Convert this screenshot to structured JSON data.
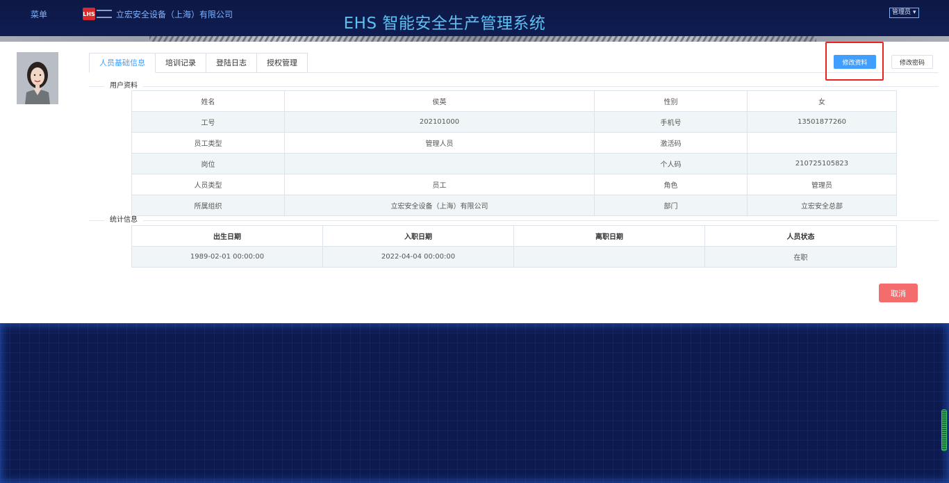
{
  "header": {
    "menu_label": "菜单",
    "company_name": "立宏安全设备（上海）有限公司",
    "system_title": "EHS 智能安全生产管理系统",
    "user_role": "管理员",
    "logo_text": "LHS"
  },
  "tabs": [
    {
      "label": "人员基础信息",
      "active": true
    },
    {
      "label": "培训记录",
      "active": false
    },
    {
      "label": "登陆日志",
      "active": false
    },
    {
      "label": "授权管理",
      "active": false
    }
  ],
  "actions": {
    "edit_label": "修改资料",
    "password_label": "修改密码",
    "cancel_label": "取消"
  },
  "user_profile": {
    "section_title": "用户资料",
    "rows": [
      [
        "姓名",
        "侯英",
        "性别",
        "女"
      ],
      [
        "工号",
        "202101000",
        "手机号",
        "13501877260"
      ],
      [
        "员工类型",
        "管理人员",
        "激活码",
        ""
      ],
      [
        "岗位",
        "",
        "个人码",
        "210725105823"
      ],
      [
        "人员类型",
        "员工",
        "角色",
        "管理员"
      ],
      [
        "所属组织",
        "立宏安全设备（上海）有限公司",
        "部门",
        "立宏安全总部"
      ]
    ]
  },
  "statistics": {
    "section_title": "统计信息",
    "headers": [
      "出生日期",
      "入职日期",
      "离职日期",
      "人员状态"
    ],
    "rows": [
      [
        "1989-02-01 00:00:00",
        "2022-04-04 00:00:00",
        "",
        "在职"
      ]
    ]
  },
  "colors": {
    "primary": "#409eff",
    "danger": "#f56c6c",
    "highlight": "#e8231d",
    "header_bg": "#0d1845",
    "title": "#5cc0f2"
  }
}
